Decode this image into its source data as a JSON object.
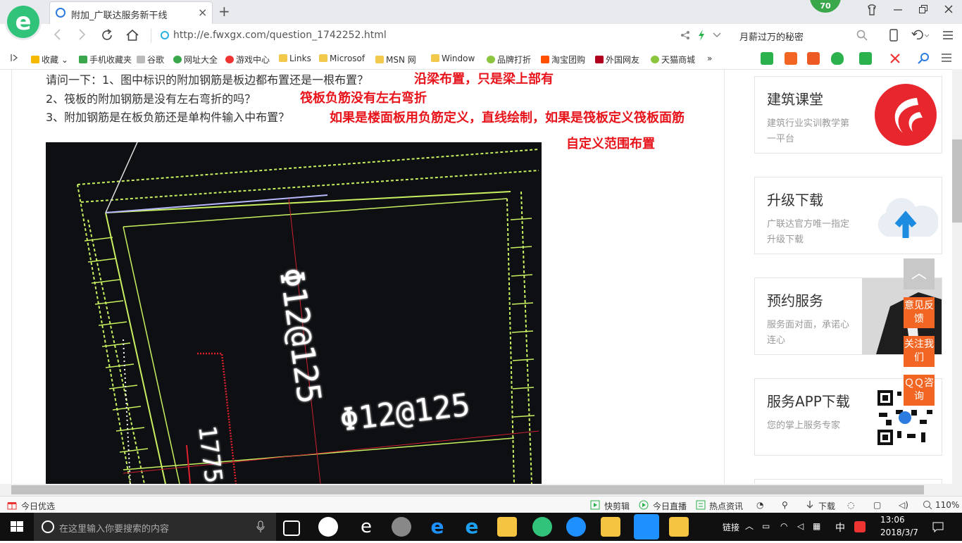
{
  "browser": {
    "tab_title": "附加_广联达服务新干线",
    "tab_close": "×",
    "new_tab": "+",
    "badge": "70",
    "url": "http://e.fwxgx.com/question_1742252.html",
    "search_text": "月薪过万的秘密"
  },
  "bookmarks": [
    {
      "label": "收藏",
      "icon": "star-icon",
      "color": "#f5b800"
    },
    {
      "label": "手机收藏夹",
      "icon": "phone-icon",
      "color": "#3aa84a"
    },
    {
      "label": "谷歌",
      "icon": "page-icon",
      "color": "#bbbbbb"
    },
    {
      "label": "网址大全",
      "icon": "globe-icon",
      "color": "#3aa84a"
    },
    {
      "label": "游戏中心",
      "icon": "game-icon",
      "color": "#e33"
    },
    {
      "label": "Links",
      "icon": "folder-icon",
      "color": "#f2c94c"
    },
    {
      "label": "Microsof",
      "icon": "folder-icon",
      "color": "#f2c94c"
    },
    {
      "label": "MSN 网",
      "icon": "folder-icon",
      "color": "#f2c94c"
    },
    {
      "label": "Window",
      "icon": "folder-icon",
      "color": "#f2c94c"
    },
    {
      "label": "品牌打折",
      "icon": "leaf-icon",
      "color": "#8cc63f"
    },
    {
      "label": "淘宝团购",
      "icon": "tao-icon",
      "color": "#ff5000"
    },
    {
      "label": "外国网友",
      "icon": "flag-icon",
      "color": "#b0001e"
    },
    {
      "label": "天猫商城",
      "icon": "leaf-icon",
      "color": "#8cc63f"
    }
  ],
  "bookmark_more": "»",
  "question": {
    "line1": "请问一下：1、图中标识的附加钢筋是板边都布置还是一根布置？",
    "line2": "2、筏板的附加钢筋是没有左右弯折的吗？",
    "line3": "3、附加钢筋是在板负筋还是单构件输入中布置？"
  },
  "answers": {
    "a1": "沿梁布置，只是梁上部有",
    "a2": "筏板负筋没有左右弯折",
    "a3": "如果是楼面板用负筋定义，直线绘制，如果是筏板定义筏板面筋",
    "a3b": "自定义范围布置"
  },
  "cad": {
    "label1": "Φ12@125",
    "label2": "Φ12@125",
    "label3": "1775"
  },
  "sidebar": [
    {
      "title": "建筑课堂",
      "desc": "建筑行业实训教学第一平台",
      "icon": "course-logo-icon"
    },
    {
      "title": "升级下载",
      "desc": "广联达官方唯一指定升级下载",
      "icon": "cloud-upload-icon"
    },
    {
      "title": "预约服务",
      "desc": "服务面对面，承诺心连心",
      "icon": "businessman-photo"
    },
    {
      "title": "服务APP下载",
      "desc": "您的掌上服务专家",
      "icon": "qr-code-icon"
    }
  ],
  "float_buttons": {
    "back_top": "︿",
    "feedback": "意见反馈",
    "follow": "关注我们",
    "qq": "ＱＱ咨询"
  },
  "statusbar": {
    "left": "今日优选",
    "kuaijianji": "快剪辑",
    "live": "今日直播",
    "news": "热点资讯",
    "download": "下载",
    "zoom": "110%"
  },
  "taskbar": {
    "search_placeholder": "在这里输入你要搜索的内容",
    "links_label": "链接",
    "ime": "中",
    "time": "13:06",
    "date": "2018/3/7"
  }
}
